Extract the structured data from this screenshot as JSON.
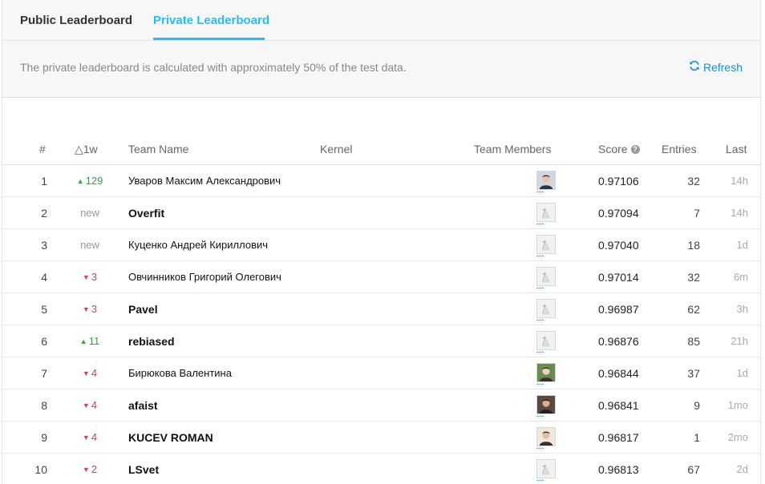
{
  "tabs": {
    "public": "Public Leaderboard",
    "private": "Private Leaderboard",
    "active": "private"
  },
  "notice": {
    "text": "The private leaderboard is calculated with approximately 50% of the test data.",
    "refresh_label": "Refresh"
  },
  "columns": {
    "rank": "#",
    "change": "△1w",
    "team": "Team Name",
    "kernel": "Kernel",
    "members": "Team Members",
    "score": "Score",
    "entries": "Entries",
    "last": "Last"
  },
  "colors": {
    "accent": "#20beff",
    "up": "#3e9d3e",
    "down": "#d43f3f"
  },
  "rows": [
    {
      "rank": "1",
      "change": "129",
      "dir": "up",
      "team": "Уваров Максим Александрович",
      "bold": false,
      "avatar": "photo-1",
      "score": "0.97106",
      "entries": "32",
      "last": "14h"
    },
    {
      "rank": "2",
      "change": "new",
      "dir": "new",
      "team": "Overfit",
      "bold": true,
      "avatar": "goose",
      "score": "0.97094",
      "entries": "7",
      "last": "14h"
    },
    {
      "rank": "3",
      "change": "new",
      "dir": "new",
      "team": "Куценко Андрей Кириллович",
      "bold": false,
      "avatar": "goose",
      "score": "0.97040",
      "entries": "18",
      "last": "1d"
    },
    {
      "rank": "4",
      "change": "3",
      "dir": "down",
      "team": "Овчинников Григорий Олегович",
      "bold": false,
      "avatar": "goose",
      "score": "0.97014",
      "entries": "32",
      "last": "6m"
    },
    {
      "rank": "5",
      "change": "3",
      "dir": "down",
      "team": "Pavel",
      "bold": true,
      "avatar": "goose",
      "score": "0.96987",
      "entries": "62",
      "last": "3h"
    },
    {
      "rank": "6",
      "change": "11",
      "dir": "up",
      "team": "rebiased",
      "bold": true,
      "avatar": "goose",
      "score": "0.96876",
      "entries": "85",
      "last": "21h"
    },
    {
      "rank": "7",
      "change": "4",
      "dir": "down",
      "team": "Бирюкова Валентина",
      "bold": false,
      "avatar": "photo-2",
      "score": "0.96844",
      "entries": "37",
      "last": "1d"
    },
    {
      "rank": "8",
      "change": "4",
      "dir": "down",
      "team": "afaist",
      "bold": true,
      "avatar": "photo-3",
      "score": "0.96841",
      "entries": "9",
      "last": "1mo"
    },
    {
      "rank": "9",
      "change": "4",
      "dir": "down",
      "team": "KUCEV ROMAN",
      "bold": true,
      "avatar": "photo-4",
      "score": "0.96817",
      "entries": "1",
      "last": "2mo"
    },
    {
      "rank": "10",
      "change": "2",
      "dir": "down",
      "team": "LSvet",
      "bold": true,
      "avatar": "goose",
      "score": "0.96813",
      "entries": "67",
      "last": "2d"
    }
  ]
}
